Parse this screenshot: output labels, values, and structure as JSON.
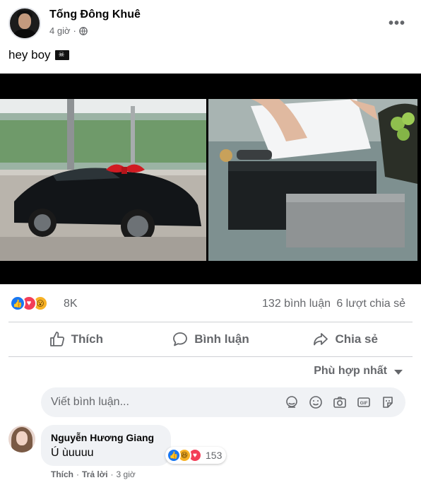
{
  "post": {
    "author": "Tống Đông Khuê",
    "time": "4 giờ",
    "caption": "hey boy",
    "more_label": "•••"
  },
  "reactions": {
    "count": "8K",
    "types": [
      "like-icon",
      "love-icon",
      "wow-icon"
    ],
    "comments": "132 bình luận",
    "shares": "6 lượt chia sẻ"
  },
  "actions": {
    "like": "Thích",
    "comment": "Bình luận",
    "share": "Chia sẻ"
  },
  "sort": {
    "label": "Phù hợp nhất"
  },
  "composer": {
    "placeholder": "Viết bình luận..."
  },
  "comment": {
    "author": "Nguyễn Hương Giang",
    "text": "Ú ùuuuu",
    "reaction_count": "153",
    "reaction_types": [
      "like-icon",
      "haha-icon",
      "love-icon"
    ],
    "like": "Thích",
    "reply": "Trả lời",
    "time": "3 giờ",
    "separator": "·"
  },
  "colors": {
    "like": "#1877f2",
    "love": "#f33e58",
    "wow": "#f7b125",
    "secondary_text": "#65676b"
  }
}
